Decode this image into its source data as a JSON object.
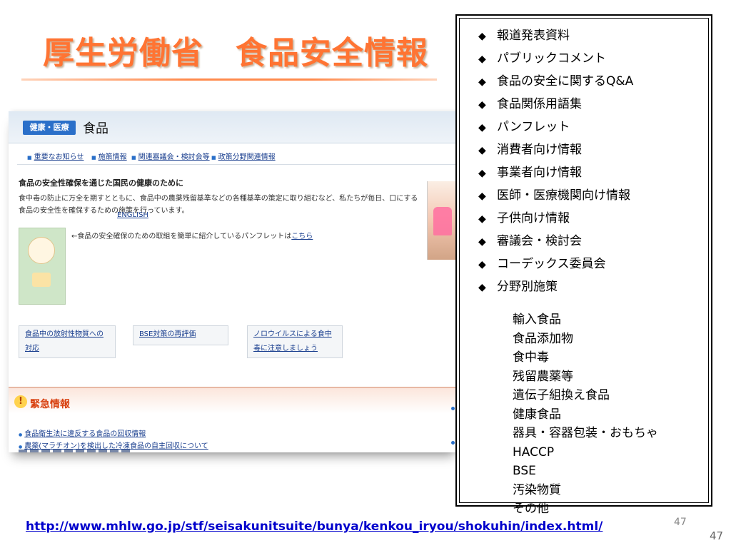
{
  "slide": {
    "title": "厚生労働省　食品安全情報",
    "url": "http://www.mhlw.go.jp/stf/seisakunitsuite/bunya/kenkou_iryou/shokuhin/index.html/",
    "page_number_inner": "47",
    "page_number_outer": "47",
    "title_color": "#ff7433"
  },
  "screenshot": {
    "category_tag": "健康・医療",
    "heading": "食品",
    "tabs": [
      "重要なお知らせ",
      "施策情報",
      "関連審議会・検討会等",
      "政策分野関連情報"
    ],
    "intro_title": "食品の安全性確保を通じた国民の健康のために",
    "intro_body": "食中毒の防止に万全を期すとともに、食品中の農薬残留基準などの各種基準の策定に取り組むなど、私たちが毎日、口にする食品の安全性を確保するための施策を行っています。",
    "english_link": "ENGLISH",
    "pamphlet_text": "←食品の安全確保のための取組を簡単に紹介しているパンフレットは",
    "pamphlet_link": "こちら",
    "features": [
      "食品中の放射性物質への対応",
      "BSE対策の再評価",
      "ノロウイルスによる食中毒に注意しましょう"
    ],
    "urgent_title": "緊急情報",
    "urgent_items": [
      "食品衛生法に違反する食品の回収情報",
      "農薬(マラチオン)を検出した冷凍食品の自主回収について"
    ]
  },
  "menu": {
    "items": [
      "報道発表資料",
      "パブリックコメント",
      "食品の安全に関するQ&A",
      "食品関係用語集",
      "パンフレット",
      "消費者向け情報",
      "事業者向け情報",
      "医師・医療機関向け情報",
      "子供向け情報",
      "審議会・検討会",
      "コーデックス委員会",
      "分野別施策"
    ],
    "bullet": "◆",
    "sub_items": [
      "輸入食品",
      "食品添加物",
      "食中毒",
      "残留農薬等",
      "遺伝子組換え食品",
      "健康食品",
      "器具・容器包装・おもちゃ",
      "HACCP",
      "BSE",
      "汚染物質",
      "その他"
    ]
  }
}
